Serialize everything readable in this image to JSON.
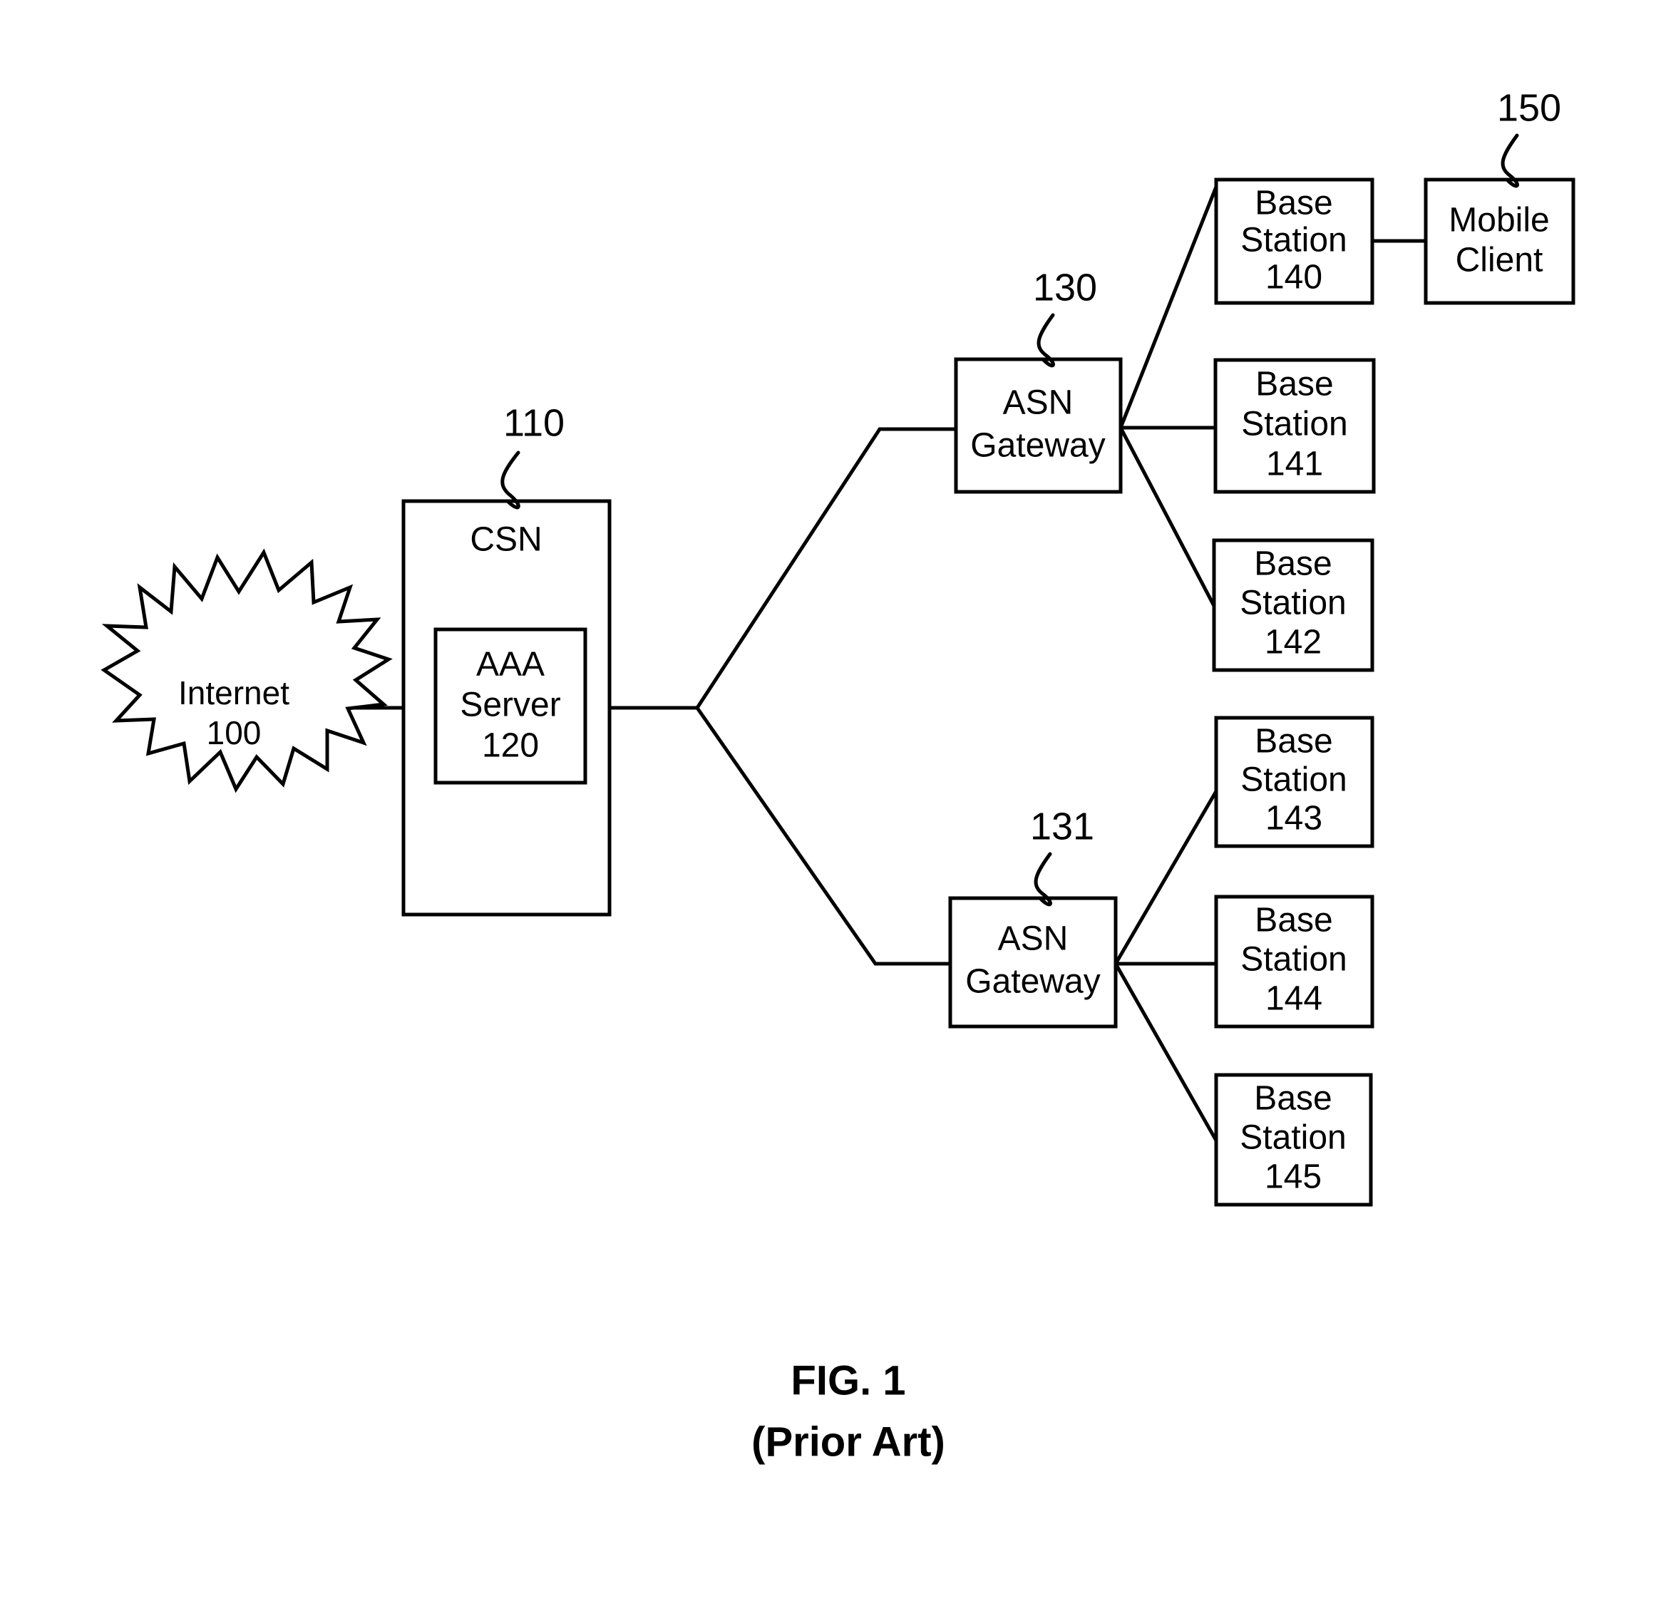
{
  "figure": {
    "caption_line1": "FIG. 1",
    "caption_line2": "(Prior Art)",
    "ink_color": "#000000",
    "background_color": "#ffffff"
  },
  "cloud": {
    "name": "Internet",
    "label_line1": "Internet",
    "label_line2": "100",
    "ref": "100"
  },
  "csn": {
    "label": "CSN",
    "ref": "110",
    "inner": {
      "label_line1": "AAA",
      "label_line2": "Server",
      "label_line3": "120",
      "ref": "120"
    }
  },
  "gateways": [
    {
      "id": "asn-gateway-130",
      "label_line1": "ASN",
      "label_line2": "Gateway",
      "ref": "130"
    },
    {
      "id": "asn-gateway-131",
      "label_line1": "ASN",
      "label_line2": "Gateway",
      "ref": "131"
    }
  ],
  "base_stations": [
    {
      "id": "base-station-140",
      "label_line1": "Base",
      "label_line2": "Station",
      "label_line3": "140",
      "ref": "140"
    },
    {
      "id": "base-station-141",
      "label_line1": "Base",
      "label_line2": "Station",
      "label_line3": "141",
      "ref": "141"
    },
    {
      "id": "base-station-142",
      "label_line1": "Base",
      "label_line2": "Station",
      "label_line3": "142",
      "ref": "142"
    },
    {
      "id": "base-station-143",
      "label_line1": "Base",
      "label_line2": "Station",
      "label_line3": "143",
      "ref": "143"
    },
    {
      "id": "base-station-144",
      "label_line1": "Base",
      "label_line2": "Station",
      "label_line3": "144",
      "ref": "144"
    },
    {
      "id": "base-station-145",
      "label_line1": "Base",
      "label_line2": "Station",
      "label_line3": "145",
      "ref": "145"
    }
  ],
  "mobile_client": {
    "label_line1": "Mobile",
    "label_line2": "Client",
    "ref": "150"
  }
}
